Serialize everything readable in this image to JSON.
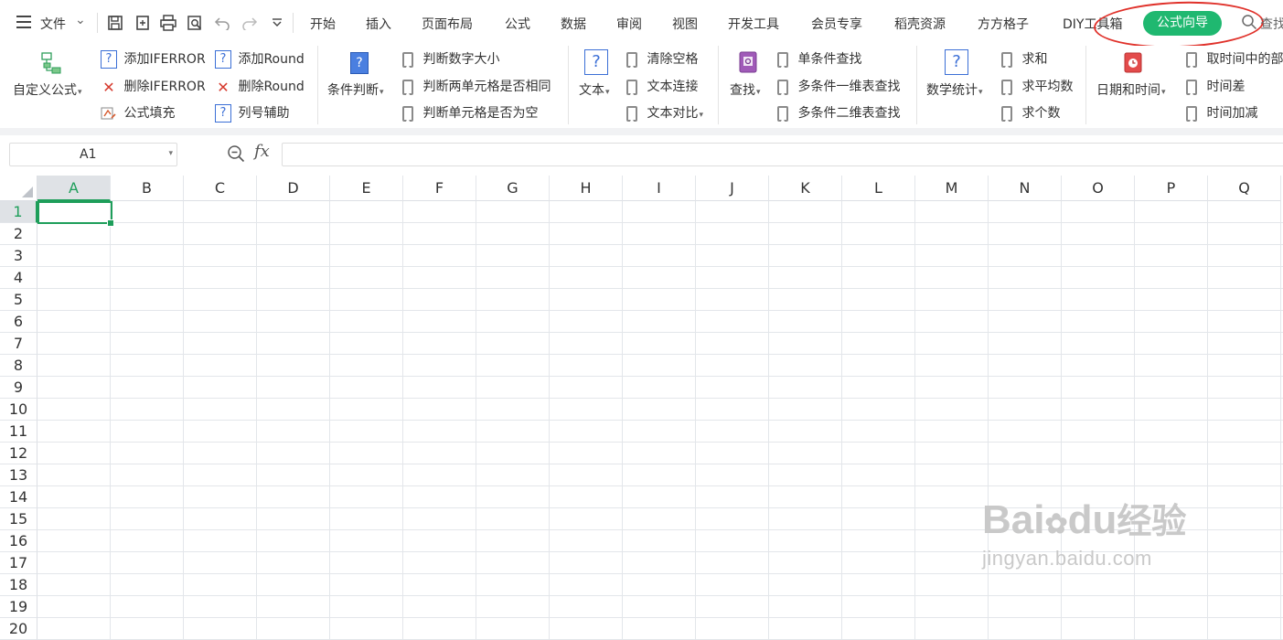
{
  "menubar": {
    "file_label": "文件",
    "tabs": [
      "开始",
      "插入",
      "页面布局",
      "公式",
      "数据",
      "审阅",
      "视图",
      "开发工具",
      "会员专享",
      "稻壳资源",
      "方方格子",
      "DIY工具箱"
    ],
    "active_tab": "公式向导",
    "active_color": "#1fb870",
    "search_label": "查找"
  },
  "ribbon": {
    "custom_formula": "自定义公式",
    "add_iferror": "添加IFERROR",
    "del_iferror": "删除IFERROR",
    "formula_fill": "公式填充",
    "add_round": "添加Round",
    "del_round": "删除Round",
    "col_aux": "列号辅助",
    "cond_judge": "条件判断",
    "judge_num_size": "判断数字大小",
    "judge_two_cells": "判断两单元格是否相同",
    "judge_cell_empty": "判断单元格是否为空",
    "text": "文本",
    "clear_spaces": "清除空格",
    "text_join": "文本连接",
    "text_compare": "文本对比",
    "lookup": "查找",
    "single_lookup": "单条件查找",
    "multi_1d_lookup": "多条件一维表查找",
    "multi_2d_lookup": "多条件二维表查找",
    "math_stats": "数学统计",
    "sum": "求和",
    "average": "求平均数",
    "count": "求个数",
    "datetime": "日期和时间",
    "get_time_part": "取时间中的部",
    "time_diff": "时间差",
    "time_add": "时间加减"
  },
  "formula_bar": {
    "cell_ref": "A1",
    "fx_label": "fx",
    "value": ""
  },
  "sheet": {
    "columns": [
      "A",
      "B",
      "C",
      "D",
      "E",
      "F",
      "G",
      "H",
      "I",
      "J",
      "K",
      "L",
      "M",
      "N",
      "O",
      "P",
      "Q"
    ],
    "rows": [
      "1",
      "2",
      "3",
      "4",
      "5",
      "6",
      "7",
      "8",
      "9",
      "10",
      "11",
      "12",
      "13",
      "14",
      "15",
      "16",
      "17",
      "18",
      "19",
      "20"
    ],
    "selected_cell": "A1",
    "selection_color": "#1e9e5a"
  },
  "watermark": {
    "brand": "Bai",
    "brand2": "du",
    "suffix": "经验",
    "url": "jingyan.baidu.com"
  },
  "annotation_color": "#e0312a"
}
